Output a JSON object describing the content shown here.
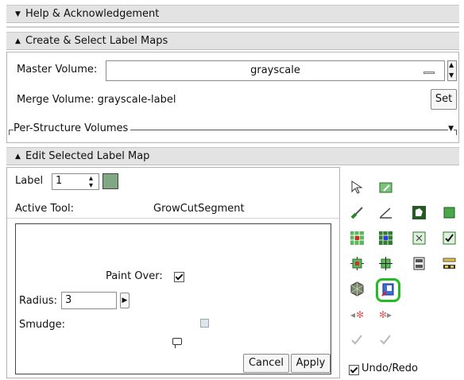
{
  "sections": {
    "help": {
      "title": "Help & Acknowledgement"
    },
    "create": {
      "title": "Create & Select Label Maps"
    },
    "edit": {
      "title": "Edit Selected Label Map"
    }
  },
  "create": {
    "master_label": "Master Volume:",
    "master_value": "grayscale",
    "merge_text": "Merge Volume: grayscale-label",
    "set_button": "Set",
    "per_structure": "Per-Structure Volumes"
  },
  "edit": {
    "label_text": "Label",
    "label_value": "1",
    "label_color": "#7fa883",
    "active_tool_label": "Active Tool:",
    "active_tool_value": "GrowCutSegment",
    "paint_over": "Paint Over:",
    "paint_over_checked": true,
    "radius_label": "Radius:",
    "radius_value": "3",
    "smudge_label": "Smudge:",
    "smudge_checked": false,
    "cancel": "Cancel",
    "apply": "Apply",
    "undo_redo": "Undo/Redo",
    "undo_redo_checked": true
  },
  "colors": {
    "accent_green": "#22bb22",
    "header_bg": "#e3e3e3"
  }
}
